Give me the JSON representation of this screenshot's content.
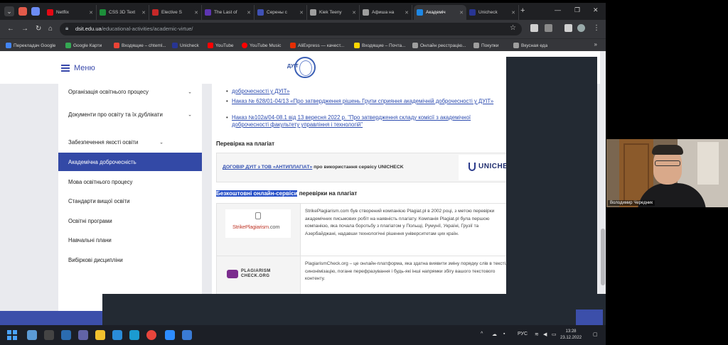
{
  "browser": {
    "tabs": [
      {
        "title": "Netflix",
        "color": "#e50914"
      },
      {
        "title": "CSS 3D Text",
        "color": "#1d8f3a"
      },
      {
        "title": "Elective S",
        "color": "#c62828"
      },
      {
        "title": "The Last of",
        "color": "#5e35b1"
      },
      {
        "title": "Серены с",
        "color": "#3f51b5"
      },
      {
        "title": "Kiek Teeny",
        "color": "#9e9e9e"
      },
      {
        "title": "Афиша на",
        "color": "#9e9e9e"
      },
      {
        "title": "Академіч",
        "color": "#1e88e5"
      },
      {
        "title": "Unicheck",
        "color": "#283593"
      }
    ],
    "new_tab": "+",
    "url_host": "dsit.edu.ua",
    "url_path": "/educational-activities/academic-virtue/",
    "bookmarks": [
      {
        "label": "Перекладач Google",
        "color": "#4285f4"
      },
      {
        "label": "Google Карти",
        "color": "#34a853"
      },
      {
        "label": "Входящие – chteml...",
        "color": "#ea4335"
      },
      {
        "label": "Unicheck",
        "color": "#283593"
      },
      {
        "label": "YouTube",
        "color": "#ff0000"
      },
      {
        "label": "YouTube Music",
        "color": "#ff0000"
      },
      {
        "label": "AliExpress — качест...",
        "color": "#e62e04"
      },
      {
        "label": "Входящие – Почта...",
        "color": "#ffd600"
      },
      {
        "label": "Онлайн реєстрацію...",
        "color": "#9e9e9e"
      },
      {
        "label": "Покупки",
        "color": "#9e9e9e"
      },
      {
        "label": "Вкусная еда",
        "color": "#9e9e9e"
      }
    ],
    "bookmarks_more": "»"
  },
  "site": {
    "menu_label": "Меню",
    "logo_text": "ДУІТ"
  },
  "sidebar": {
    "items": [
      {
        "label": "Організація освітнього процесу",
        "chevron": "⌄"
      },
      {
        "label": "Документи про освіту та їх дублікати",
        "chevron": "⌄"
      },
      {
        "label": "Забезпечення якості освіти",
        "chevron": "⌄"
      },
      {
        "label": "Академічна доброчесність",
        "chevron": ""
      },
      {
        "label": "Мова освітнього процесу",
        "chevron": ""
      },
      {
        "label": "Стандарти вищої освіти",
        "chevron": ""
      },
      {
        "label": "Освітні програми",
        "chevron": ""
      },
      {
        "label": "Навчальні плани",
        "chevron": ""
      },
      {
        "label": "Вибіркові дисципліни",
        "chevron": ""
      }
    ]
  },
  "main": {
    "link_top_tail": "доброчесності у ДУІТ»",
    "link_2": "Наказ № 628/01-04/13 «Про затвердження рішень Групи сприяння академічній доброчесності у ДУІТ»",
    "link_3a": "Наказ №102а/04-08.1 від 13 вересня 2022 р. \"Про затвердження складу комісії з академічної",
    "link_3b": "доброчесності факультету управління і технологій\"",
    "plagiarism_title": "Перевірка на плагіат",
    "contract_link": "ДОГОВІР ДУІТ з ТОВ «АНТИПЛАГІАТ»",
    "contract_text": " про використання сервісу UNICHECK",
    "unicheck_logo": "UNICHECK",
    "free_highlight": "Безкоштовні онлайн-сервіси",
    "free_rest": " перевірки на плагіат",
    "services": [
      {
        "logo": "StrikePlagiarism",
        "logo_suffix": ".com",
        "desc": "StrikePlagiarism.com був створений компанією Plagiat.pl в 2002 році, з метою перевірки академічних письмових робіт на наявність плагіату. Компанія Plagiat.pl була першою компанією, яка почала боротьбу з плагіатом у Польщі, Румунії, Україні, Грузії та Азербайджані, надавши технологічні рішення університетам цих країн."
      },
      {
        "logo_line1": "PLAGIARISM",
        "logo_line2": "CHECK.ORG",
        "desc": "PlagiarismCheck.org – це онлайн-платформа, яка здатна виявити зміну порядку слів в тексті, синонімізацію, погане перефразування і будь-які інші напрямки збігу вашого текстового контенту."
      }
    ]
  },
  "webcam": {
    "name": "Володимир Чередник"
  },
  "taskbar": {
    "lang": "РУС",
    "time": "13:28",
    "date": "23.12.2022"
  }
}
